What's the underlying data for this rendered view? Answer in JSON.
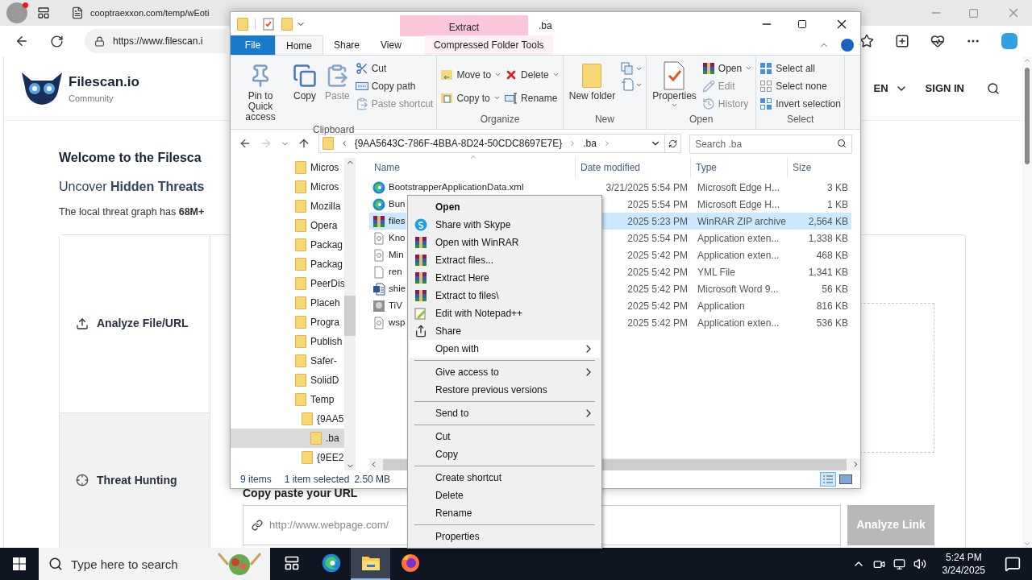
{
  "browser": {
    "tab": {
      "label": "cooptraexxon.com/temp/wEoti",
      "selected": false
    },
    "address": "https://www.filescan.i",
    "page": {
      "logo": {
        "name": "Filescan.io",
        "tagline": "Community"
      },
      "language": "EN",
      "sign_in": "SIGN IN",
      "headline": "Welcome to the Filesca",
      "subheadline": "Uncover **Hidden Threats**",
      "stats_line": "The local threat graph has **68M+**",
      "sidebar": [
        {
          "label": "Analyze File/URL",
          "selected": true
        },
        {
          "label": "Threat Hunting",
          "selected": false
        }
      ],
      "url_label": "Copy paste your URL",
      "url_field": {
        "placeholder": "http://www.webpage.com/"
      },
      "analyze_button": {
        "label": "Analyze Link",
        "disabled": true
      }
    }
  },
  "explorer": {
    "title": ".ba",
    "context_group": "Extract",
    "tabs": [
      {
        "label": "File",
        "kind": "file",
        "selected": false
      },
      {
        "label": "Home",
        "kind": "tab",
        "selected": true
      },
      {
        "label": "Share",
        "kind": "tab",
        "selected": false
      },
      {
        "label": "View",
        "kind": "tab",
        "selected": false
      },
      {
        "label": "Compressed Folder Tools",
        "kind": "context",
        "selected": false
      }
    ],
    "ribbon": [
      {
        "title": "Clipboard",
        "items": [
          {
            "kind": "large",
            "label": "Pin to Quick access",
            "dropdown": false,
            "disabled": false
          },
          {
            "kind": "large",
            "label": "Copy",
            "dropdown": false,
            "disabled": false
          },
          {
            "kind": "large",
            "label": "Paste",
            "dropdown": false,
            "disabled": true
          },
          {
            "kind": "small",
            "label": "Cut",
            "dropdown": false,
            "disabled": false
          },
          {
            "kind": "small",
            "label": "Copy path",
            "dropdown": false,
            "disabled": false
          },
          {
            "kind": "small",
            "label": "Paste shortcut",
            "dropdown": false,
            "disabled": true
          }
        ]
      },
      {
        "title": "Organize",
        "items": [
          {
            "kind": "small",
            "label": "Move to",
            "dropdown": true,
            "disabled": false
          },
          {
            "kind": "small",
            "label": "Copy to",
            "dropdown": true,
            "disabled": false
          },
          {
            "kind": "small",
            "label": "Delete",
            "dropdown": true,
            "disabled": false
          },
          {
            "kind": "small",
            "label": "Rename",
            "dropdown": false,
            "disabled": false
          }
        ]
      },
      {
        "title": "New",
        "items": [
          {
            "kind": "large",
            "label": "New folder",
            "dropdown": false,
            "disabled": false
          },
          {
            "kind": "icon",
            "dropdown": true,
            "disabled": false
          },
          {
            "kind": "icon",
            "dropdown": true,
            "disabled": false
          }
        ]
      },
      {
        "title": "Open",
        "items": [
          {
            "kind": "large",
            "label": "Properties",
            "dropdown": true,
            "disabled": false
          },
          {
            "kind": "small",
            "label": "Open",
            "dropdown": true,
            "disabled": false
          },
          {
            "kind": "small",
            "label": "Edit",
            "dropdown": false,
            "disabled": true
          },
          {
            "kind": "small",
            "label": "History",
            "dropdown": false,
            "disabled": true
          }
        ]
      },
      {
        "title": "Select",
        "items": [
          {
            "kind": "small",
            "label": "Select all",
            "dropdown": false,
            "disabled": false
          },
          {
            "kind": "small",
            "label": "Select none",
            "dropdown": false,
            "disabled": false
          },
          {
            "kind": "small",
            "label": "Invert selection",
            "dropdown": false,
            "disabled": false
          }
        ]
      }
    ],
    "breadcrumbs": [
      "{9AA5643C-786F-4BBA-8D24-50CDC8697E7E}",
      ".ba"
    ],
    "search": {
      "placeholder": "Search .ba"
    },
    "tree": [
      {
        "label": "Micros",
        "selected": false
      },
      {
        "label": "Micros",
        "selected": false
      },
      {
        "label": "Mozilla",
        "selected": false
      },
      {
        "label": "Opera",
        "selected": false
      },
      {
        "label": "Packag",
        "selected": false
      },
      {
        "label": "Packag",
        "selected": false
      },
      {
        "label": "PeerDis",
        "selected": false
      },
      {
        "label": "Placeh",
        "selected": false
      },
      {
        "label": "Progra",
        "selected": false
      },
      {
        "label": "Publish",
        "selected": false
      },
      {
        "label": "Safer-",
        "selected": false
      },
      {
        "label": "SolidD",
        "selected": false
      },
      {
        "label": "Temp",
        "selected": false,
        "children": [
          {
            "label": "{9AA5",
            "selected": false,
            "children": [
              {
                "label": ".ba",
                "selected": true
              }
            ]
          },
          {
            "label": "{9EE2",
            "selected": false
          }
        ]
      }
    ],
    "columns": [
      "Name",
      "Date modified",
      "Type",
      "Size"
    ],
    "files": [
      {
        "name": "BootstrapperApplicationData.xml",
        "date": "3/21/2025 5:54 PM",
        "type": "Microsoft Edge H...",
        "size": "3 KB",
        "kind": "edge",
        "selected": false
      },
      {
        "name": "Bun",
        "date": "2025 5:54 PM",
        "type": "Microsoft Edge H...",
        "size": "1 KB",
        "kind": "edge",
        "selected": false
      },
      {
        "name": "files",
        "date": "2025 5:23 PM",
        "type": "WinRAR ZIP archive",
        "size": "2,564 KB",
        "kind": "archive",
        "selected": true
      },
      {
        "name": "Kno",
        "date": "2025 5:54 PM",
        "type": "Application exten...",
        "size": "1,338 KB",
        "kind": "extension",
        "selected": false
      },
      {
        "name": "Min",
        "date": "2025 5:42 PM",
        "type": "Application exten...",
        "size": "468 KB",
        "kind": "extension",
        "selected": false
      },
      {
        "name": "ren",
        "date": "2025 5:42 PM",
        "type": "YML File",
        "size": "1,341 KB",
        "kind": "text",
        "selected": false
      },
      {
        "name": "shie",
        "date": "2025 5:42 PM",
        "type": "Microsoft Word 9...",
        "size": "56 KB",
        "kind": "document",
        "selected": false
      },
      {
        "name": "TiV",
        "date": "2025 5:42 PM",
        "type": "Application",
        "size": "816 KB",
        "kind": "application",
        "selected": false
      },
      {
        "name": "wsp",
        "date": "2025 5:42 PM",
        "type": "Application exten...",
        "size": "536 KB",
        "kind": "extension",
        "selected": false
      }
    ],
    "status": {
      "count": "9 items",
      "selection": "1 item selected",
      "size": "2.50 MB"
    }
  },
  "context_menu": [
    {
      "kind": "item",
      "label": "Open",
      "default": true,
      "submenu": false,
      "selected": false
    },
    {
      "kind": "item",
      "label": "Share with Skype",
      "default": false,
      "submenu": false,
      "selected": false
    },
    {
      "kind": "item",
      "label": "Open with WinRAR",
      "default": false,
      "submenu": false,
      "selected": false
    },
    {
      "kind": "item",
      "label": "Extract files...",
      "default": false,
      "submenu": false,
      "selected": false
    },
    {
      "kind": "item",
      "label": "Extract Here",
      "default": false,
      "submenu": false,
      "selected": false
    },
    {
      "kind": "item",
      "label": "Extract to files\\",
      "default": false,
      "submenu": false,
      "selected": false
    },
    {
      "kind": "item",
      "label": "Edit with Notepad++",
      "default": false,
      "submenu": false,
      "selected": false
    },
    {
      "kind": "item",
      "label": "Share",
      "default": false,
      "submenu": false,
      "selected": false
    },
    {
      "kind": "item",
      "label": "Open with",
      "default": false,
      "submenu": true,
      "selected": true
    },
    {
      "kind": "separator"
    },
    {
      "kind": "item",
      "label": "Give access to",
      "default": false,
      "submenu": true,
      "selected": false
    },
    {
      "kind": "item",
      "label": "Restore previous versions",
      "default": false,
      "submenu": false,
      "selected": false
    },
    {
      "kind": "separator"
    },
    {
      "kind": "item",
      "label": "Send to",
      "default": false,
      "submenu": true,
      "selected": false
    },
    {
      "kind": "separator"
    },
    {
      "kind": "item",
      "label": "Cut",
      "default": false,
      "submenu": false,
      "selected": false
    },
    {
      "kind": "item",
      "label": "Copy",
      "default": false,
      "submenu": false,
      "selected": false
    },
    {
      "kind": "separator"
    },
    {
      "kind": "item",
      "label": "Create shortcut",
      "default": false,
      "submenu": false,
      "selected": false
    },
    {
      "kind": "item",
      "label": "Delete",
      "default": false,
      "submenu": false,
      "selected": false
    },
    {
      "kind": "item",
      "label": "Rename",
      "default": false,
      "submenu": false,
      "selected": false
    },
    {
      "kind": "separator"
    },
    {
      "kind": "item",
      "label": "Properties",
      "default": false,
      "submenu": false,
      "selected": false
    }
  ],
  "taskbar": {
    "search": {
      "placeholder": "Type here to search"
    },
    "apps": [
      {
        "selected": false
      },
      {
        "selected": false
      },
      {
        "selected": true
      },
      {
        "selected": false
      }
    ],
    "time": "5:24 PM",
    "date": "3/24/2025"
  }
}
